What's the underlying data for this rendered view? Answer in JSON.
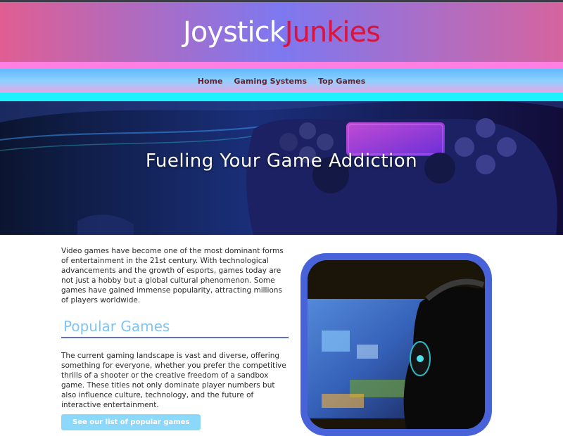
{
  "site": {
    "logo_part1": "Joystick",
    "logo_part2": "Junkies"
  },
  "nav": {
    "items": [
      "Home",
      "Gaming Systems",
      "Top Games"
    ]
  },
  "hero": {
    "title": "Fueling Your Game Addiction"
  },
  "main": {
    "intro": "Video games have become one of the most dominant forms of entertainment in the 21st century. With technological advancements and the growth of esports, games today are not just a hobby but a global cultural phenomenon. Some games have gained immense popularity, attracting millions of players worldwide.",
    "section_title": "Popular Games",
    "section_text": "The current gaming landscape is vast and diverse, offering something for everyone, whether you prefer the competitive thrills of a shooter or the creative freedom of a sandbox game. These titles not only dominate player numbers but also influence culture, technology, and the future of interactive entertainment.",
    "button_label": "See our list of popular games"
  },
  "colors": {
    "accent_blue": "#4863da",
    "logo_red": "#d9143e",
    "nav_text": "#6b1f2c",
    "heading": "#7fc4f2",
    "button": "#8cd8fb"
  },
  "images": {
    "hero": "gamepad-controller-photo",
    "side": "headphones-gamer-photo"
  }
}
